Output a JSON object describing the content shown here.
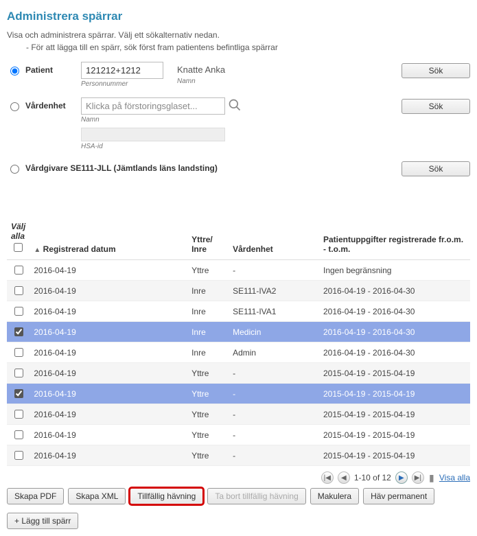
{
  "title": "Administrera spärrar",
  "intro": "Visa och administrera spärrar. Välj ett sökalternativ nedan.",
  "intro_sub": "- För att lägga till en spärr, sök först fram patientens befintliga spärrar",
  "search": {
    "patient": {
      "label": "Patient",
      "personnummer_value": "121212+1212",
      "personnummer_sublabel": "Personnummer",
      "namn_value": "Knatte Anka",
      "namn_sublabel": "Namn",
      "button": "Sök"
    },
    "vardenhet": {
      "label": "Vårdenhet",
      "namn_placeholder": "Klicka på förstoringsglaset...",
      "namn_sublabel": "Namn",
      "hsaid_sublabel": "HSA-id",
      "button": "Sök"
    },
    "vardgivare": {
      "label": "Vårdgivare SE111-JLL (Jämtlands läns landsting)",
      "button": "Sök"
    }
  },
  "table": {
    "headers": {
      "select_all": "Välj alla",
      "reg_date": "Registrerad datum",
      "yttre_inre": "Yttre/ Inre",
      "vardenhet": "Vårdenhet",
      "patientuppgifter": "Patientuppgifter registrerade fr.o.m. - t.o.m."
    },
    "rows": [
      {
        "sel": false,
        "date": "2016-04-19",
        "yi": "Yttre",
        "ve": "-",
        "pu": "Ingen begränsning"
      },
      {
        "sel": false,
        "date": "2016-04-19",
        "yi": "Inre",
        "ve": "SE111-IVA2",
        "pu": "2016-04-19 - 2016-04-30"
      },
      {
        "sel": false,
        "date": "2016-04-19",
        "yi": "Inre",
        "ve": "SE111-IVA1",
        "pu": "2016-04-19 - 2016-04-30"
      },
      {
        "sel": true,
        "date": "2016-04-19",
        "yi": "Inre",
        "ve": "Medicin",
        "pu": "2016-04-19 - 2016-04-30"
      },
      {
        "sel": false,
        "date": "2016-04-19",
        "yi": "Inre",
        "ve": "Admin",
        "pu": "2016-04-19 - 2016-04-30"
      },
      {
        "sel": false,
        "date": "2016-04-19",
        "yi": "Yttre",
        "ve": "-",
        "pu": "2015-04-19 - 2015-04-19"
      },
      {
        "sel": true,
        "date": "2016-04-19",
        "yi": "Yttre",
        "ve": "-",
        "pu": "2015-04-19 - 2015-04-19"
      },
      {
        "sel": false,
        "date": "2016-04-19",
        "yi": "Yttre",
        "ve": "-",
        "pu": "2015-04-19 - 2015-04-19"
      },
      {
        "sel": false,
        "date": "2016-04-19",
        "yi": "Yttre",
        "ve": "-",
        "pu": "2015-04-19 - 2015-04-19"
      },
      {
        "sel": false,
        "date": "2016-04-19",
        "yi": "Yttre",
        "ve": "-",
        "pu": "2015-04-19 - 2015-04-19"
      }
    ]
  },
  "pager": {
    "range": "1-10 of 12",
    "show_all": "Visa alla"
  },
  "actions": {
    "skapa_pdf": "Skapa PDF",
    "skapa_xml": "Skapa XML",
    "tillfallig_havning": "Tillfällig hävning",
    "ta_bort_tillfallig": "Ta bort tillfällig hävning",
    "makulera": "Makulera",
    "hav_permanent": "Häv permanent",
    "lagg_till_sparr": "+ Lägg till spärr"
  }
}
